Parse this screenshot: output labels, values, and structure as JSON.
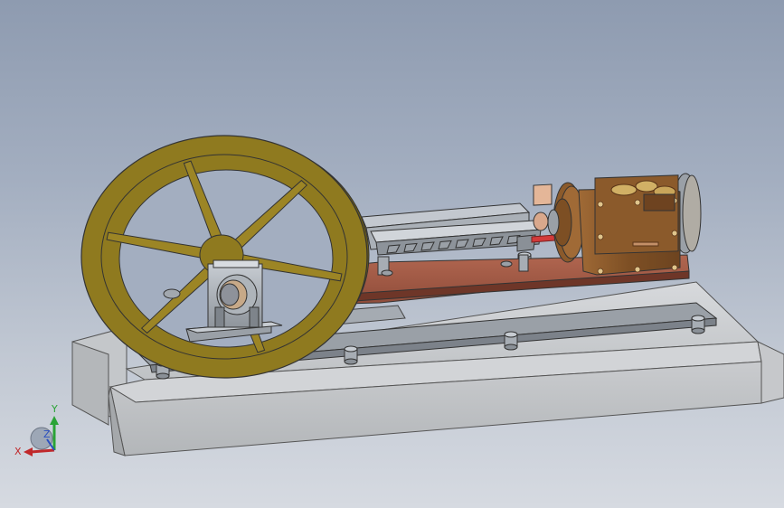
{
  "viewport": {
    "background_top": "#8e9bb0",
    "background_bottom": "#d6dae1"
  },
  "model": {
    "colors": {
      "flywheel": "#8f7a1f",
      "flywheel_light": "#b09830",
      "base": "#b9bcbf",
      "bed_plate": "#9c5540",
      "cylinder": "#8b5a2b",
      "steel": "#a9afb6",
      "piston_rod": "#d23a3a",
      "connecting_rod": "#d8c79a"
    },
    "parts": [
      "base",
      "bed-plate",
      "flywheel",
      "main-bearing",
      "crosshead-guide",
      "connecting-rod",
      "piston-rod",
      "cylinder",
      "steam-chest",
      "crank-bracket"
    ]
  },
  "triad": {
    "x_label": "X",
    "y_label": "Y",
    "z_label": "Z",
    "x_color": "#c0282a",
    "y_color": "#2aa336",
    "z_color": "#2a4fc0"
  }
}
